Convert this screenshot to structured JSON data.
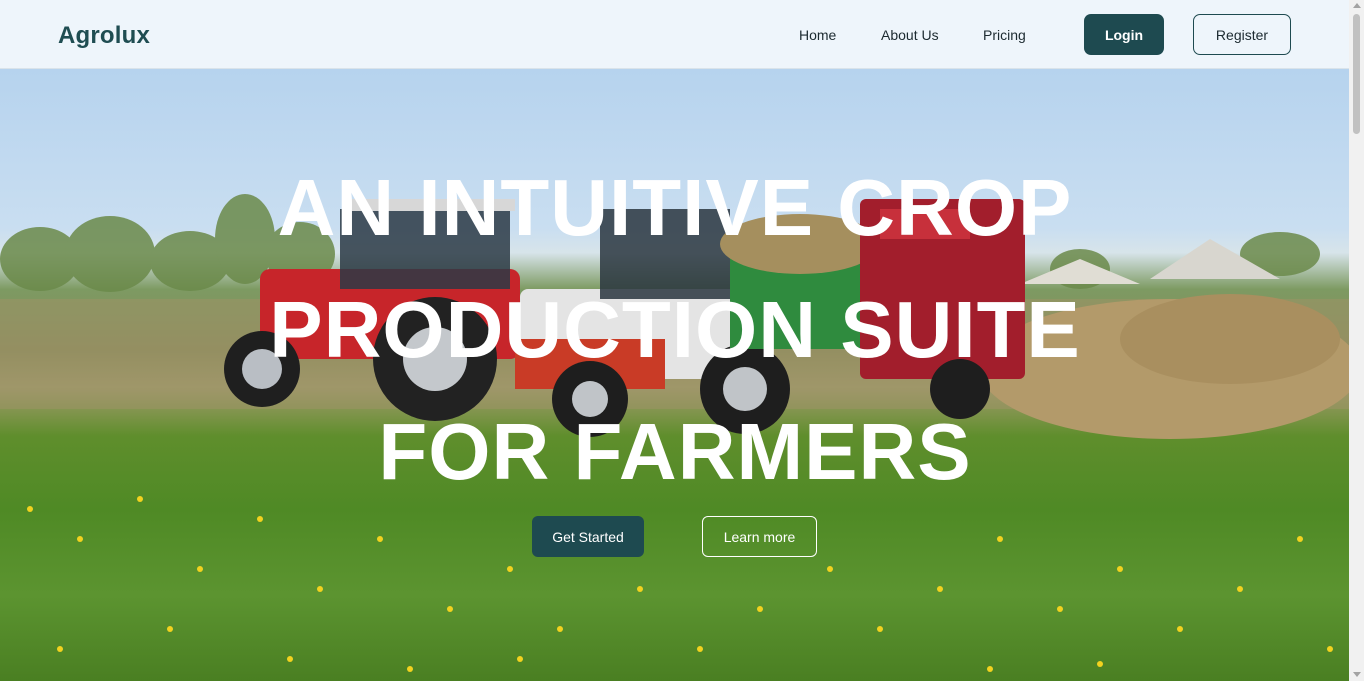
{
  "brand": {
    "name": "Agrolux"
  },
  "nav": {
    "links": [
      "Home",
      "About Us",
      "Pricing"
    ],
    "login_label": "Login",
    "register_label": "Register"
  },
  "hero": {
    "title_lines": [
      "AN INTUITIVE CROP",
      "PRODUCTION SUITE",
      "FOR FARMERS"
    ],
    "primary_cta": "Get Started",
    "secondary_cta": "Learn more",
    "image_subject": "tractors in a farm field with grass and dandelions"
  },
  "colors": {
    "brand": "#1f4d52",
    "button_primary": "#1e4a50",
    "navbar_bg": "#eef5fb",
    "hero_text": "#ffffff"
  }
}
